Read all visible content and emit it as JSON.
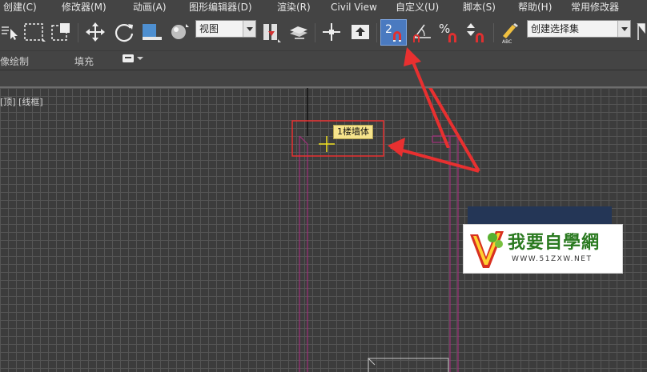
{
  "menu": {
    "items": [
      "创建(C)",
      "修改器(M)",
      "动画(A)",
      "图形编辑器(D)",
      "渲染(R)",
      "Civil View",
      "自定义(U)",
      "脚本(S)",
      "帮助(H)",
      "常用修改器"
    ]
  },
  "toolbar": {
    "view_combo": "视图",
    "snap_button_label": "2",
    "angle_snap_label": "",
    "percent_snap_label": "%",
    "selection_set_combo": "创建选择集"
  },
  "ribbon": {
    "item1": "像绘制",
    "item2": "填充"
  },
  "viewport": {
    "label": "[顶] [线框]",
    "tooltip": "1楼墙体"
  },
  "logo": {
    "title": "我要自學網",
    "url": "WWW.51ZXW.NET"
  },
  "colors": {
    "bg": "#444444",
    "grid": "#555555",
    "snap_active": "#4a7ac0",
    "wall_lines": "#a0307a",
    "annotation_red": "#e83030",
    "tooltip_bg": "#f7e48c",
    "logo_bg": "#243656"
  }
}
